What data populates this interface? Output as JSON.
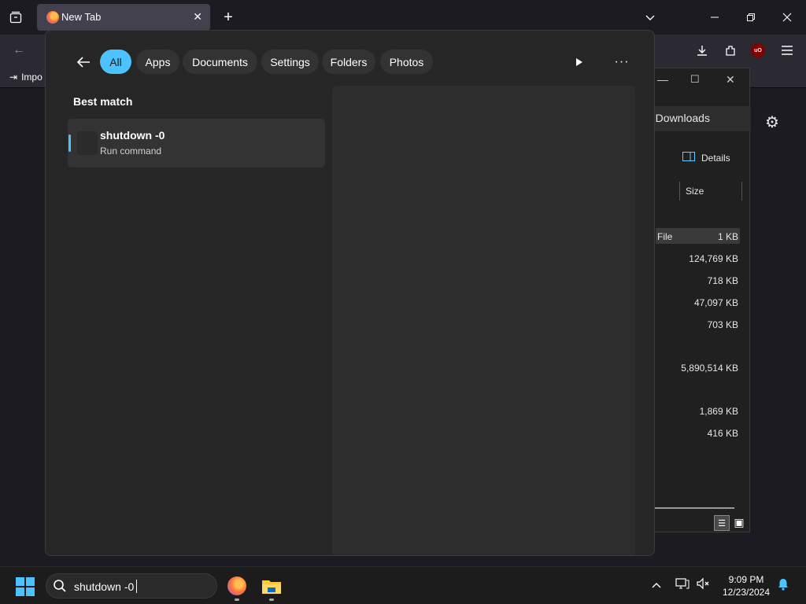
{
  "browser": {
    "tab_title": "New Tab",
    "bookmark_label": "Impo"
  },
  "explorer": {
    "search_text": "h Downloads",
    "details_label": "Details",
    "size_header": "Size",
    "rows": [
      {
        "type": "File",
        "size": "1 KB",
        "selected": true
      },
      {
        "type": "",
        "size": "124,769 KB"
      },
      {
        "type": "",
        "size": "718 KB"
      },
      {
        "type": "",
        "size": "47,097 KB"
      },
      {
        "type": "",
        "size": "703 KB"
      },
      {
        "type": "",
        "size": "5,890,514 KB"
      },
      {
        "type": "",
        "size": "1,869 KB"
      },
      {
        "type": "",
        "size": "416 KB"
      }
    ]
  },
  "search": {
    "filters": [
      {
        "label": "All",
        "active": true
      },
      {
        "label": "Apps",
        "active": false
      },
      {
        "label": "Documents",
        "active": false
      },
      {
        "label": "Settings",
        "active": false
      },
      {
        "label": "Folders",
        "active": false
      },
      {
        "label": "Photos",
        "active": false
      }
    ],
    "best_match_label": "Best match",
    "result": {
      "name": "shutdown -0",
      "subtitle": "Run command"
    }
  },
  "taskbar": {
    "search_value": "shutdown -0",
    "time": "9:09 PM",
    "date": "12/23/2024"
  },
  "colors": {
    "accent": "#4cc2ff",
    "flyout_bg": "#262626",
    "preview_bg": "#2d2d2d",
    "browser_bg": "#1c1b22"
  }
}
